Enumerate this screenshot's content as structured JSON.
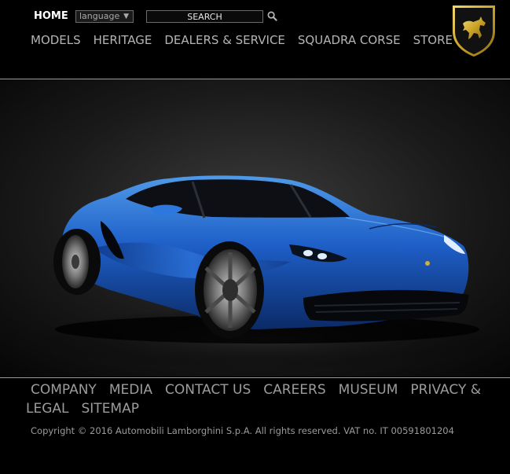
{
  "header": {
    "home_label": "HOME",
    "language_label": "language",
    "search_placeholder": "SEARCH",
    "main_nav": [
      "MODELS",
      "HERITAGE",
      "DEALERS & SERVICE",
      "SQUADRA CORSE",
      "STORE"
    ],
    "logo_text": "LAMBORGHINI"
  },
  "hero": {
    "image": "blue-lamborghini-asterion-car"
  },
  "footer": {
    "links": [
      "COMPANY",
      "MEDIA",
      "CONTACT US",
      "CAREERS",
      "MUSEUM",
      "PRIVACY & LEGAL",
      "SITEMAP"
    ],
    "copyright": "Copyright © 2016 Automobili Lamborghini S.p.A. All rights reserved. VAT no. IT 00591801204"
  },
  "colors": {
    "background": "#000000",
    "nav_text": "#b4b4b4",
    "car_blue": "#1e5fc8",
    "logo_gold": "#c9a227"
  }
}
